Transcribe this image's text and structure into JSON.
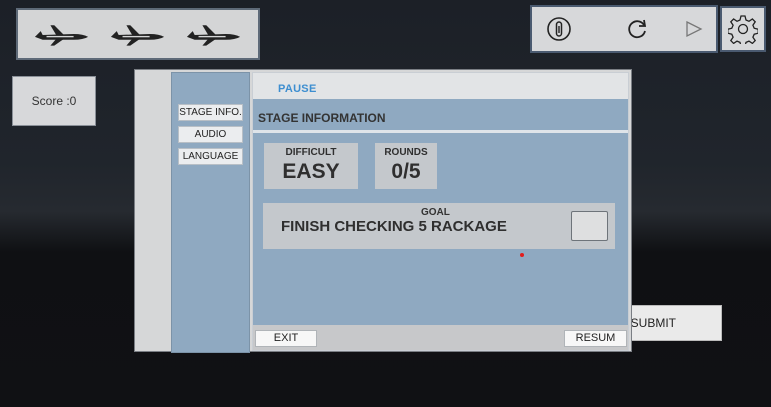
{
  "top_bar": {
    "plane_icons": [
      "airplane-icon",
      "airplane-icon",
      "airplane-icon"
    ]
  },
  "toolbar": {
    "icons": [
      "info-icon",
      "refresh-icon",
      "play-icon",
      "settings-icon"
    ]
  },
  "score": {
    "label": "Score :0"
  },
  "submit": {
    "label": "SUBMIT"
  },
  "dialog": {
    "title": "PAUSE",
    "menu": [
      "STAGE INFO.",
      "AUDIO",
      "LANGUAGE"
    ],
    "header": "STAGE INFORMATION",
    "difficult": {
      "label": "DIFFICULT",
      "value": "EASY"
    },
    "rounds": {
      "label": "ROUNDS",
      "value": "0/5"
    },
    "goal": {
      "label": "GOAL",
      "text": "FINISH CHECKING 5 RACKAGE"
    },
    "exit_label": "EXIT",
    "resume_label": "RESUM"
  }
}
